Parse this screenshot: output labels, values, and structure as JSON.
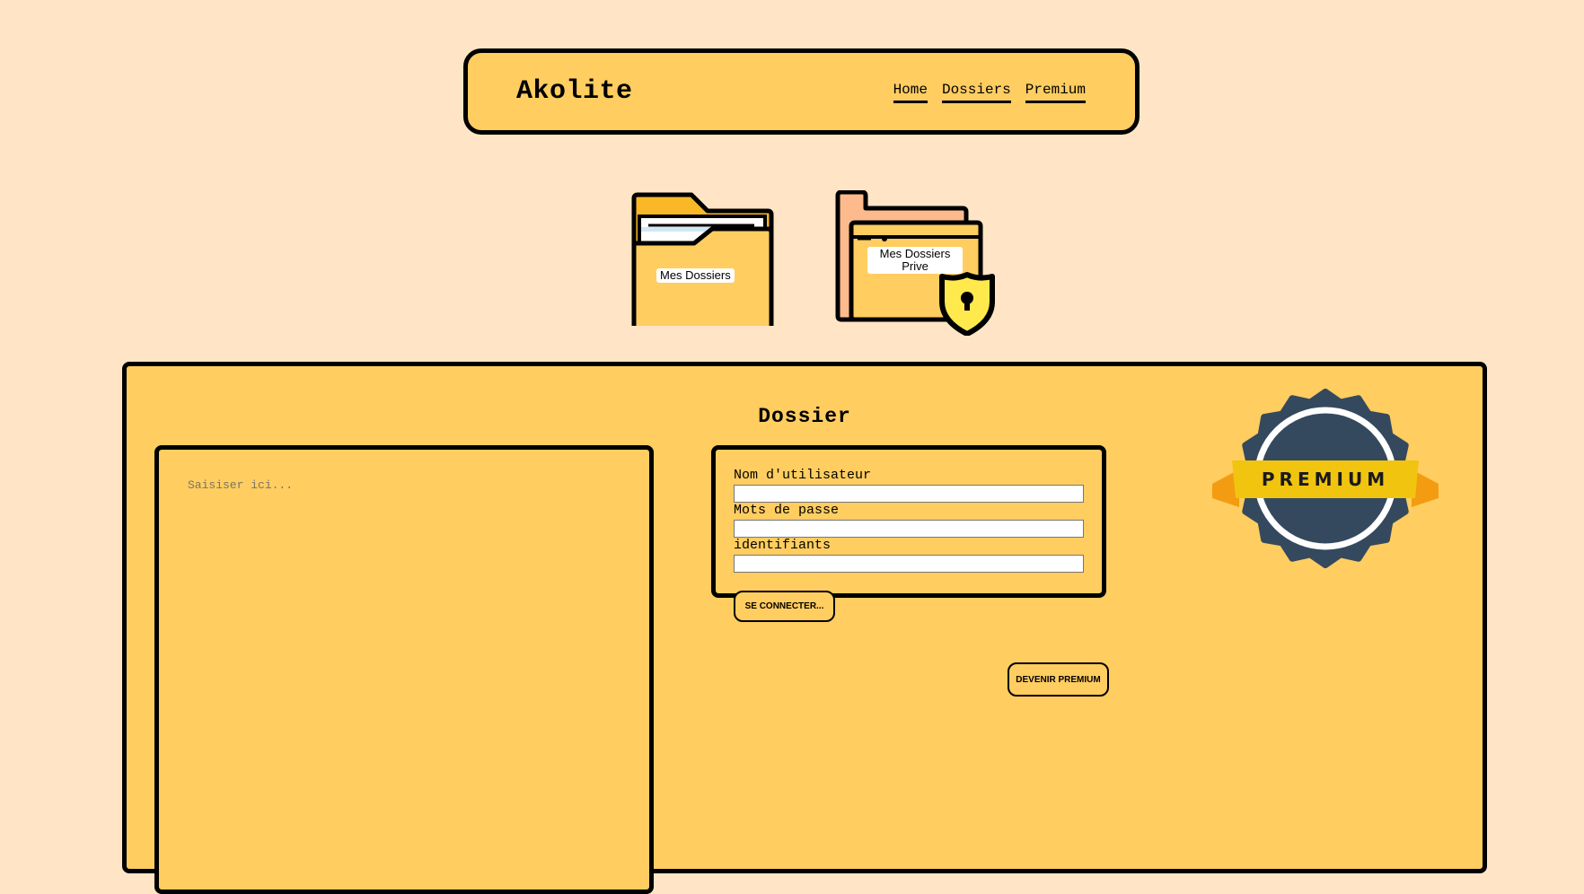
{
  "header": {
    "logo": "Akolite",
    "nav": [
      "Home",
      "Dossiers",
      "Premium"
    ]
  },
  "folders": {
    "mine_label": "Mes Dossiers",
    "private_label": "Mes Dossiers Prive"
  },
  "panel": {
    "title": "Dossier",
    "notes_placeholder": "Saisiser ici...",
    "login": {
      "username_label": "Nom d'utilisateur",
      "password_label": "Mots de passe",
      "id_label": "identifiants",
      "submit_label": "SE CONNECTER..."
    },
    "premium_button": "DEVENIR PREMIUM",
    "badge_text": "PREMIUM"
  },
  "colors": {
    "background": "#ffe5c5",
    "panel": "#ffcd60",
    "badge_navy": "#34495e",
    "ribbon": "#f1c40f",
    "ribbon_tail": "#f39c12"
  }
}
